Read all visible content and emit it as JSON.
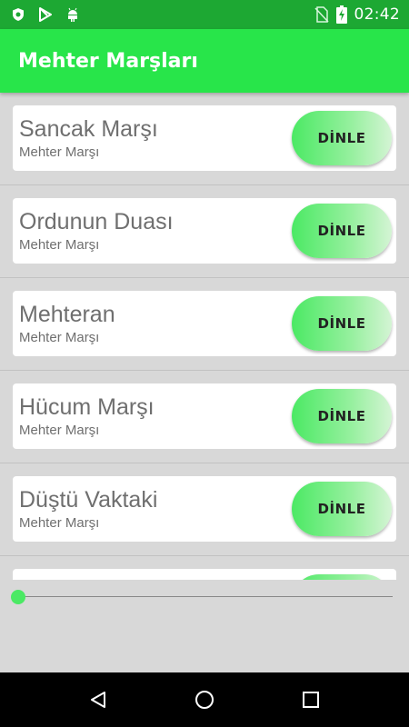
{
  "status_bar": {
    "time": "02:42",
    "icons": [
      "shield-icon",
      "play-store-icon",
      "android-icon",
      "no-sim-icon",
      "battery-charging-icon"
    ]
  },
  "app_bar": {
    "title": "Mehter Marşları"
  },
  "songs": [
    {
      "title": "Sancak Marşı",
      "subtitle": "Mehter Marşı",
      "button": "DİNLE"
    },
    {
      "title": "Ordunun Duası",
      "subtitle": "Mehter Marşı",
      "button": "DİNLE"
    },
    {
      "title": "Mehteran",
      "subtitle": "Mehter Marşı",
      "button": "DİNLE"
    },
    {
      "title": "Hücum Marşı",
      "subtitle": "Mehter Marşı",
      "button": "DİNLE"
    },
    {
      "title": "Düştü Vaktaki",
      "subtitle": "Mehter Marşı",
      "button": "DİNLE"
    },
    {
      "title": "",
      "subtitle": "",
      "button": ""
    }
  ],
  "player": {
    "progress": 0
  },
  "colors": {
    "status_bar": "#1da833",
    "app_bar": "#28e54a",
    "accent": "#4be964"
  },
  "nav_bar": {
    "icons": [
      "back-icon",
      "home-icon",
      "recents-icon"
    ]
  }
}
